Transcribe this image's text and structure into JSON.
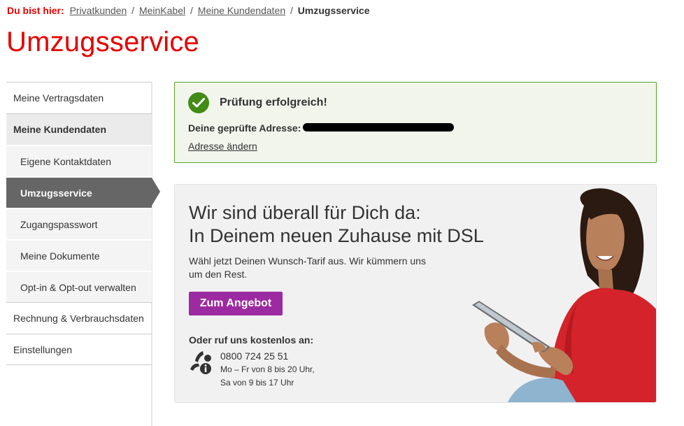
{
  "breadcrumb": {
    "prefix": "Du bist hier:",
    "links": [
      "Privatkunden",
      "MeinKabel",
      "Meine Kundendaten"
    ],
    "separator": "/",
    "current": "Umzugsservice"
  },
  "page_title": "Umzugsservice",
  "sidebar": {
    "items": [
      {
        "label": "Meine Vertragsdaten"
      },
      {
        "label": "Meine Kundendaten"
      },
      {
        "label": "Eigene Kontaktdaten"
      },
      {
        "label": "Umzugsservice"
      },
      {
        "label": "Zugangspasswort"
      },
      {
        "label": "Meine Dokumente"
      },
      {
        "label": "Opt-in & Opt-out verwalten"
      },
      {
        "label": "Rechnung & Verbrauchsdaten"
      },
      {
        "label": "Einstellungen"
      }
    ]
  },
  "success": {
    "title": "Prüfung erfolgreich!",
    "address_label": "Deine geprüfte Adresse:",
    "change_link": "Adresse ändern"
  },
  "promo": {
    "heading_line1": "Wir sind überall für Dich da:",
    "heading_line2": "In Deinem neuen Zuhause mit DSL",
    "text": "Wähl jetzt Deinen Wunsch-Tarif aus. Wir kümmern uns um den Rest.",
    "button": "Zum Angebot",
    "call_label": "Oder ruf uns kostenlos an:",
    "phone": "0800 724 25 51",
    "hours_weekday": "Mo – Fr von 8 bis 20 Uhr,",
    "hours_saturday": "Sa von 9 bis 17 Uhr"
  },
  "colors": {
    "brand_red": "#e60000",
    "active_nav": "#666666",
    "success_green": "#428c16",
    "button_purple": "#9c2aa0"
  },
  "icons": {
    "success": "check-circle-icon",
    "phone": "phone-info-icon"
  }
}
